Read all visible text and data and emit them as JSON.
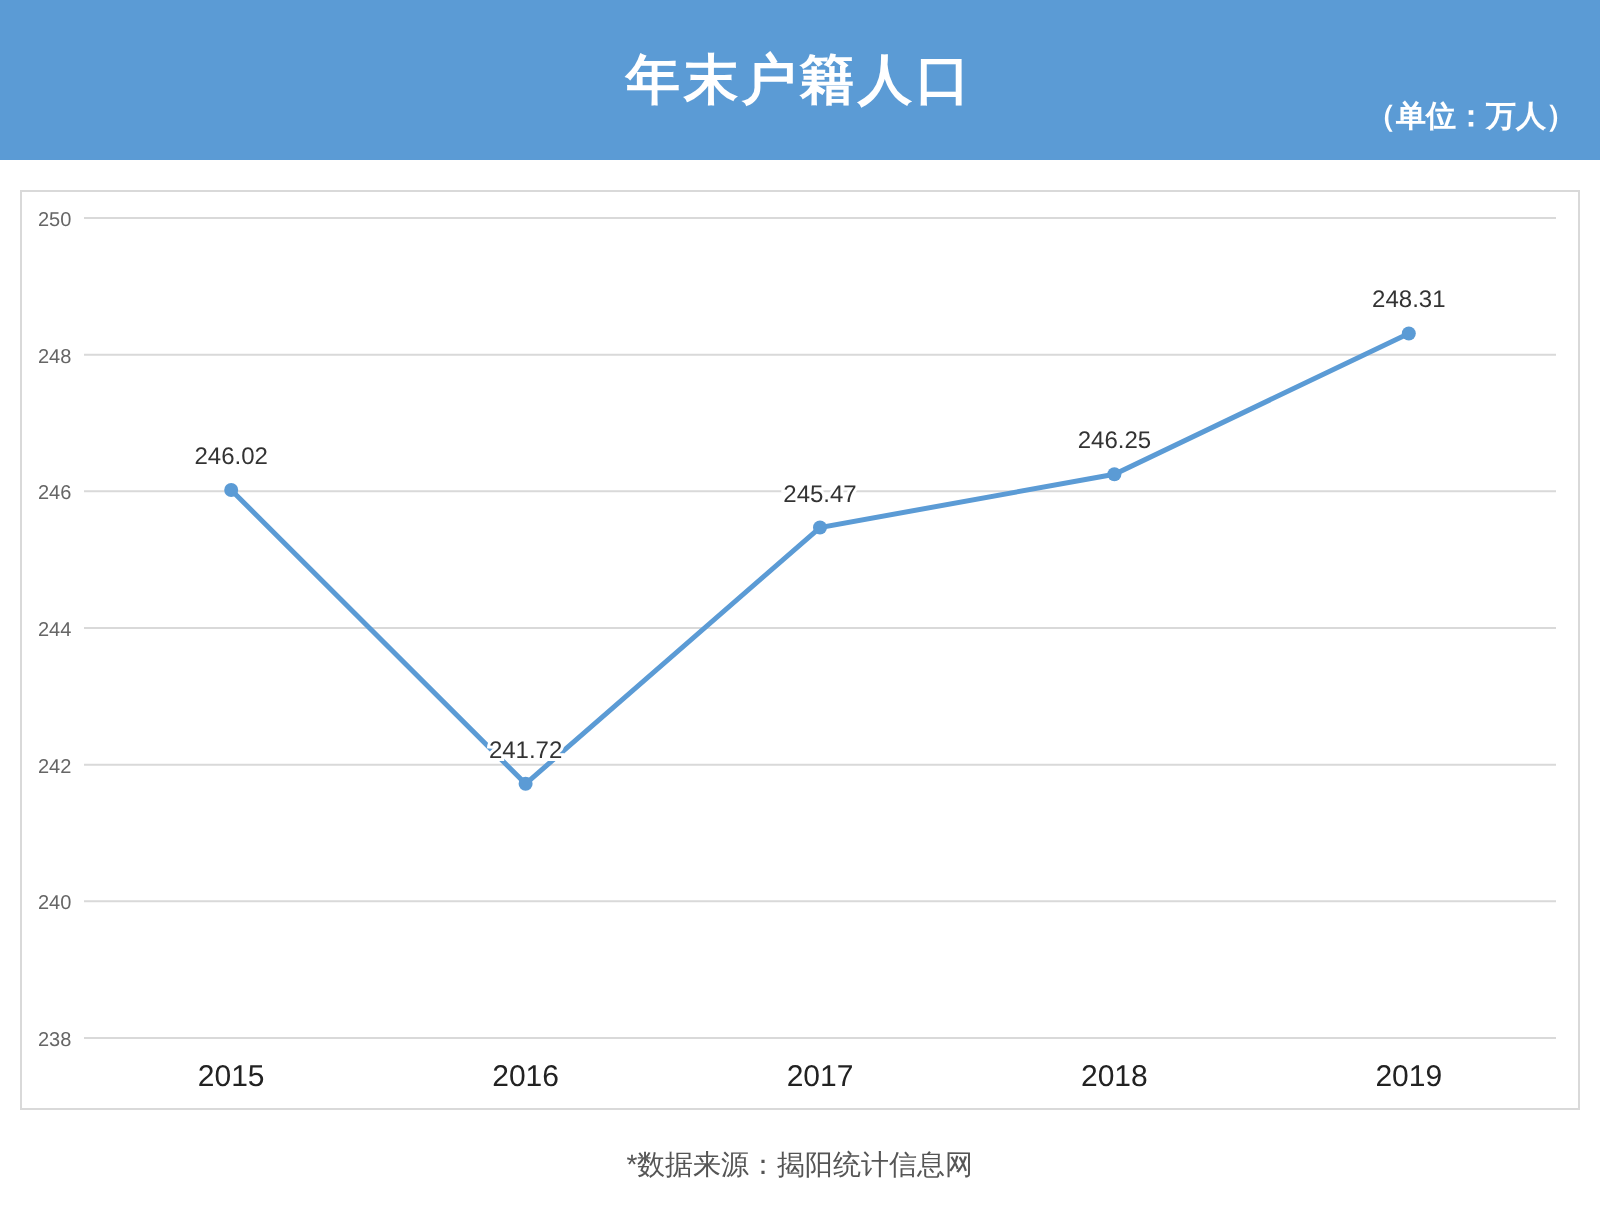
{
  "header": {
    "title": "年末户籍人口",
    "unit": "（单位：万人）"
  },
  "chart": {
    "chart_data": {
      "type": "line",
      "categories": [
        "2015",
        "2016",
        "2017",
        "2018",
        "2019"
      ],
      "series": [
        {
          "color": "#5b9bd5",
          "marker": true,
          "values": [
            246.02,
            241.72,
            245.47,
            246.25,
            248.31
          ]
        }
      ],
      "grid": true,
      "ylim": [
        238,
        250
      ],
      "yticks": [
        238,
        240,
        242,
        244,
        246,
        248,
        250
      ],
      "data_labels": true,
      "value_labels": [
        "246.02",
        "241.72",
        "245.47",
        "246.25",
        "248.31"
      ]
    }
  },
  "source": "*数据来源：揭阳统计信息网"
}
